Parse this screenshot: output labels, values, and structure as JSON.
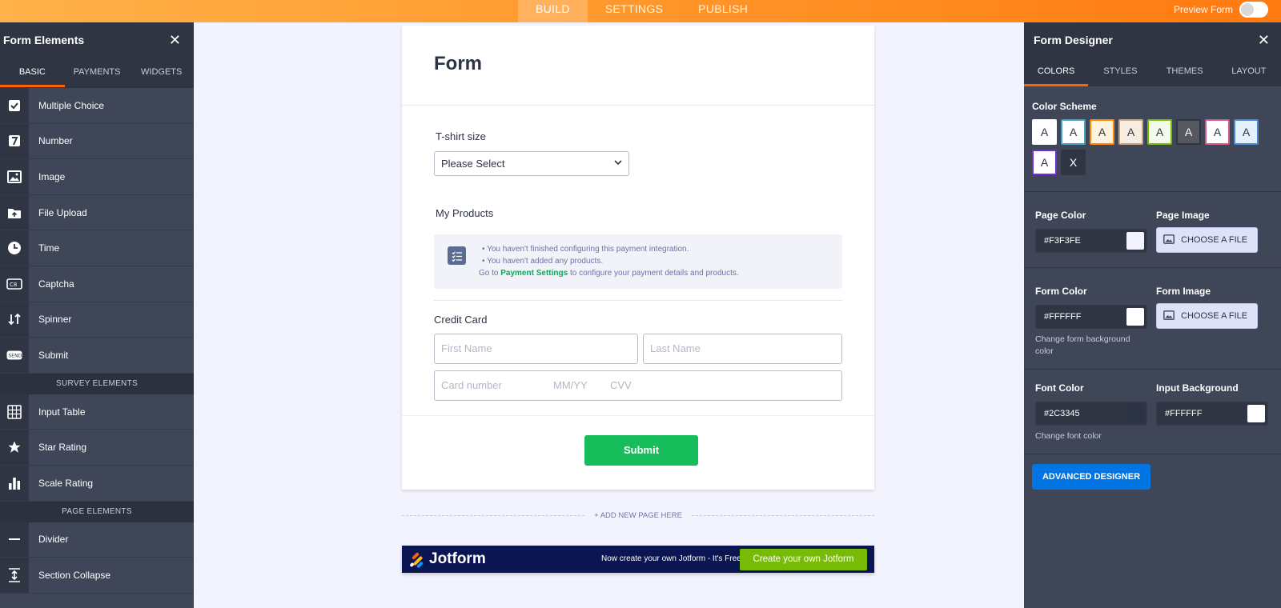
{
  "topbar": {
    "tabs": [
      {
        "label": "BUILD",
        "active": true
      },
      {
        "label": "SETTINGS",
        "active": false
      },
      {
        "label": "PUBLISH",
        "active": false
      }
    ],
    "preview_label": "Preview Form"
  },
  "left_panel": {
    "title": "Form Elements",
    "tabs": [
      "BASIC",
      "PAYMENTS",
      "WIDGETS"
    ],
    "basic_items": [
      {
        "label": "Multiple Choice",
        "icon": "checkbox-icon"
      },
      {
        "label": "Number",
        "icon": "number-icon"
      },
      {
        "label": "Image",
        "icon": "image-icon"
      },
      {
        "label": "File Upload",
        "icon": "file-upload-icon"
      },
      {
        "label": "Time",
        "icon": "clock-icon"
      },
      {
        "label": "Captcha",
        "icon": "captcha-icon"
      },
      {
        "label": "Spinner",
        "icon": "spinner-icon"
      },
      {
        "label": "Submit",
        "icon": "send-icon"
      }
    ],
    "survey_header": "SURVEY ELEMENTS",
    "survey_items": [
      {
        "label": "Input Table",
        "icon": "table-icon"
      },
      {
        "label": "Star Rating",
        "icon": "star-icon"
      },
      {
        "label": "Scale Rating",
        "icon": "bar-chart-icon"
      }
    ],
    "page_header": "PAGE ELEMENTS",
    "page_items": [
      {
        "label": "Divider",
        "icon": "divider-icon"
      },
      {
        "label": "Section Collapse",
        "icon": "section-collapse-icon"
      }
    ]
  },
  "form": {
    "title": "Form",
    "tshirt_label": "T-shirt size",
    "select_value": "Please Select",
    "products_label": "My Products",
    "info_line1": "You haven't finished configuring this payment integration.",
    "info_line2": "You haven't added any products.",
    "info_line3_pre": "Go to",
    "info_link": "Payment Settings",
    "info_line3_post": "to configure your payment details and products.",
    "cc_label": "Credit Card",
    "first_name_placeholder": "First Name",
    "last_name_placeholder": "Last Name",
    "card_number_placeholder": "Card number",
    "mmyy_placeholder": "MM/YY",
    "cvv_placeholder": "CVV",
    "submit_label": "Submit",
    "add_page_label": "+ ADD NEW PAGE HERE"
  },
  "banner": {
    "logo_text": "Jotform",
    "text": "Now create your own Jotform - It's Free",
    "button_label": "Create your own Jotform"
  },
  "right_panel": {
    "title": "Form Designer",
    "tabs": [
      "COLORS",
      "STYLES",
      "THEMES",
      "LAYOUT"
    ],
    "color_scheme_label": "Color Scheme",
    "swatches": [
      {
        "letter": "A",
        "bg": "#FFFFFF",
        "fg": "#2C3345",
        "border": "#FFFFFF"
      },
      {
        "letter": "A",
        "bg": "#FFFFFF",
        "fg": "#2C3345",
        "border": "#4AA3C4"
      },
      {
        "letter": "A",
        "bg": "#FFF3E0",
        "fg": "#2C3345",
        "border": "#FF8A00"
      },
      {
        "letter": "A",
        "bg": "#F5EDE2",
        "fg": "#2C3345",
        "border": "#C9A67A"
      },
      {
        "letter": "A",
        "bg": "#F3FAEC",
        "fg": "#2C3345",
        "border": "#78BB07"
      },
      {
        "letter": "A",
        "bg": "#55595F",
        "fg": "#FFFFFF",
        "border": "#2F3543"
      },
      {
        "letter": "A",
        "bg": "#FFFFFF",
        "fg": "#2C3345",
        "border": "#D15C8A"
      },
      {
        "letter": "A",
        "bg": "#E6F0FB",
        "fg": "#2C3345",
        "border": "#4A8AD4"
      },
      {
        "letter": "A",
        "bg": "#FFFFFF",
        "fg": "#2C3345",
        "border": "#6E2FD8"
      },
      {
        "letter": "X",
        "bg": "#2F3543",
        "fg": "#FFFFFF",
        "border": "#2F3543"
      }
    ],
    "page_color_label": "Page Color",
    "page_color_value": "#F3F3FE",
    "page_image_label": "Page Image",
    "choose_file_label": "CHOOSE A FILE",
    "form_color_label": "Form Color",
    "form_color_value": "#FFFFFF",
    "form_color_hint": "Change form background color",
    "form_image_label": "Form Image",
    "font_color_label": "Font Color",
    "font_color_value": "#2C3345",
    "font_color_hint": "Change font color",
    "input_bg_label": "Input Background",
    "input_bg_value": "#FFFFFF",
    "advanced_label": "ADVANCED DESIGNER"
  },
  "colors": {
    "accent": "#FF6100",
    "panel": "#3E4657",
    "panel_dark": "#2F3543",
    "submit_green": "#18BD5B",
    "banner_navy": "#0A1551",
    "banner_green": "#78BB07",
    "blue_button": "#0075E3"
  }
}
